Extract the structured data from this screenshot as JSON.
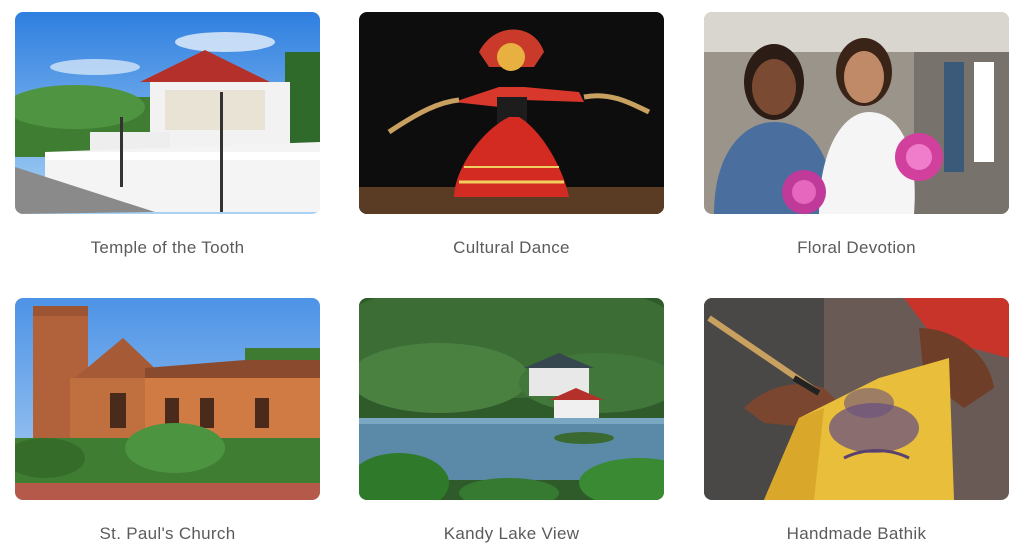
{
  "gallery": {
    "items": [
      {
        "caption": "Temple of the Tooth",
        "image": "temple-photo"
      },
      {
        "caption": "Cultural Dance",
        "image": "dancer-photo"
      },
      {
        "caption": "Floral Devotion",
        "image": "flower-offering-photo"
      },
      {
        "caption": "St. Paul's Church",
        "image": "church-photo"
      },
      {
        "caption": "Kandy Lake View",
        "image": "lake-photo"
      },
      {
        "caption": "Handmade Bathik",
        "image": "batik-photo"
      }
    ]
  }
}
